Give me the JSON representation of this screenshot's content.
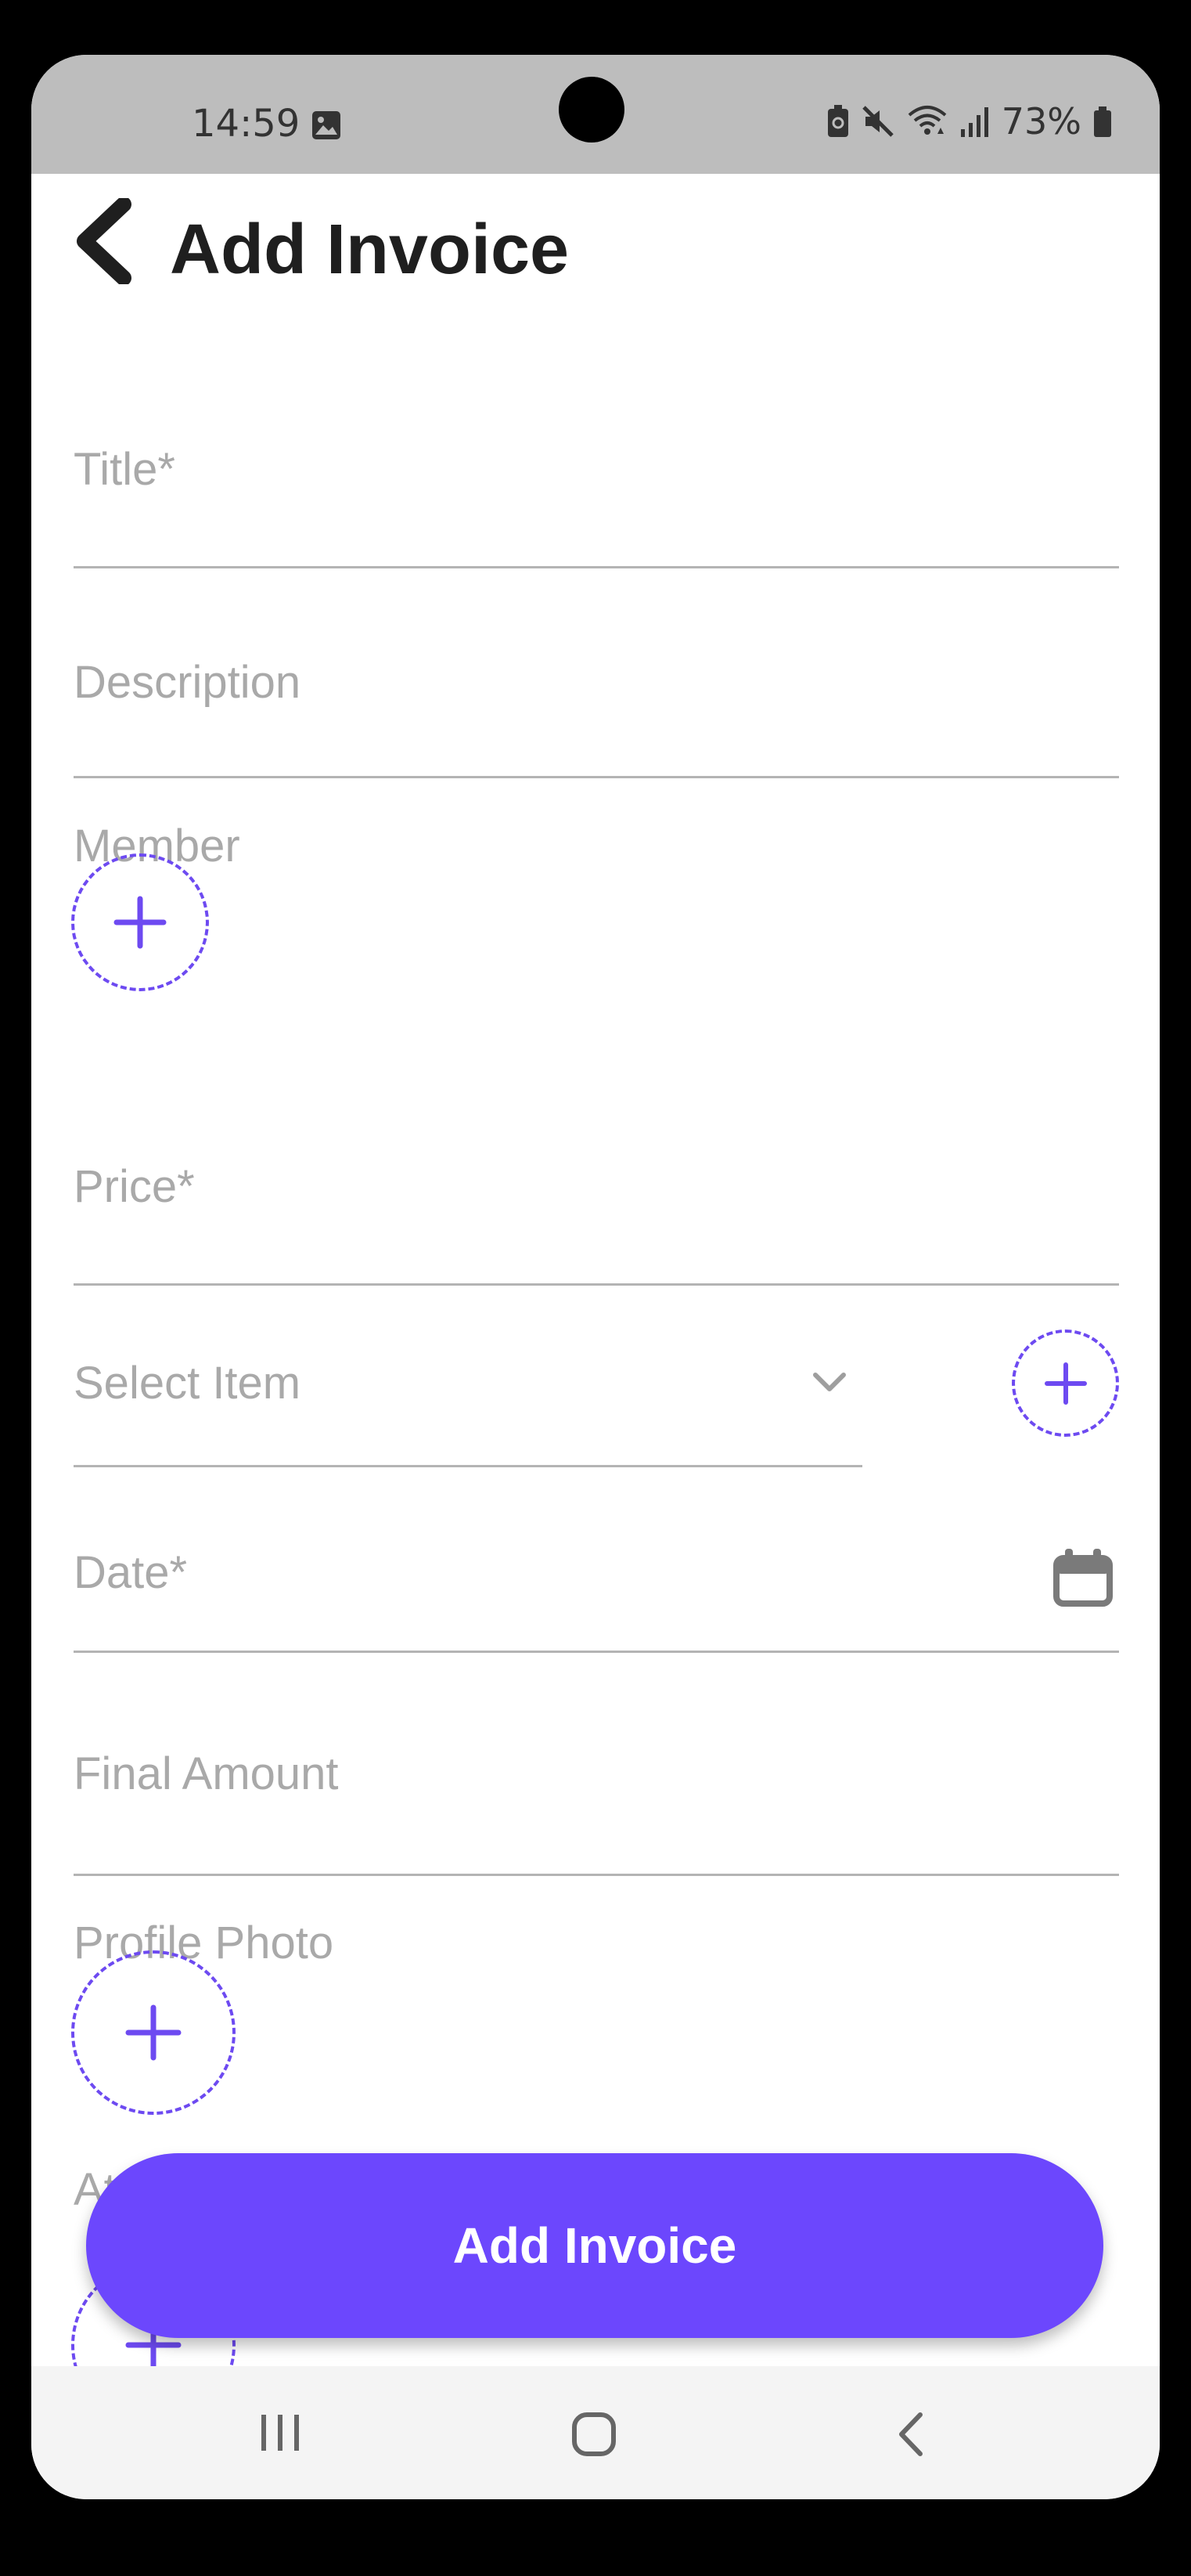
{
  "status_bar": {
    "time": "14:59",
    "battery": "73%",
    "icons": [
      "gallery-icon",
      "battery-saver-icon",
      "mute-icon",
      "wifi-icon",
      "signal-icon",
      "battery-icon"
    ]
  },
  "header": {
    "title": "Add Invoice",
    "back_icon": "chevron-left-icon"
  },
  "form": {
    "title_placeholder": "Title*",
    "description_placeholder": "Description",
    "member_label": "Member",
    "price_placeholder": "Price*",
    "select_item_placeholder": "Select Item",
    "date_placeholder": "Date*",
    "final_amount_placeholder": "Final Amount",
    "profile_photo_label": "Profile Photo",
    "partial_label": "At"
  },
  "submit_label": "Add Invoice",
  "colors": {
    "accent": "#6C47FD",
    "placeholder": "#A9A9A9",
    "title": "#1F1F1F",
    "status_bar": "#BDBDBD"
  },
  "nav": {
    "icons": [
      "recent-apps-icon",
      "home-icon",
      "back-icon"
    ]
  }
}
